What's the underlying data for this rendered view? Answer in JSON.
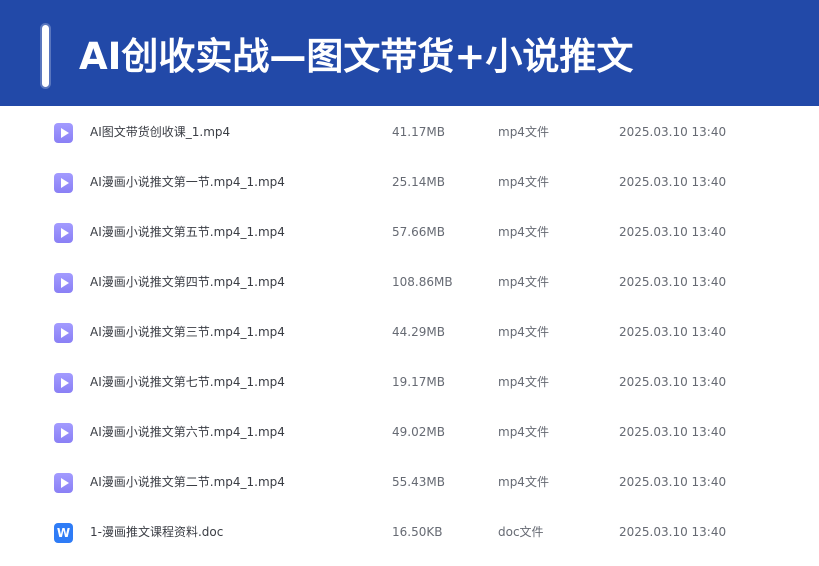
{
  "header": {
    "title": "AI创收实战—图文带货+小说推文"
  },
  "files": [
    {
      "icon": "video-file-icon",
      "name": "AI图文带货创收课_1.mp4",
      "size": "41.17MB",
      "type": "mp4文件",
      "modified": "2025.03.10 13:40"
    },
    {
      "icon": "video-file-icon",
      "name": "AI漫画小说推文第一节.mp4_1.mp4",
      "size": "25.14MB",
      "type": "mp4文件",
      "modified": "2025.03.10 13:40"
    },
    {
      "icon": "video-file-icon",
      "name": "AI漫画小说推文第五节.mp4_1.mp4",
      "size": "57.66MB",
      "type": "mp4文件",
      "modified": "2025.03.10 13:40"
    },
    {
      "icon": "video-file-icon",
      "name": "AI漫画小说推文第四节.mp4_1.mp4",
      "size": "108.86MB",
      "type": "mp4文件",
      "modified": "2025.03.10 13:40"
    },
    {
      "icon": "video-file-icon",
      "name": "AI漫画小说推文第三节.mp4_1.mp4",
      "size": "44.29MB",
      "type": "mp4文件",
      "modified": "2025.03.10 13:40"
    },
    {
      "icon": "video-file-icon",
      "name": "AI漫画小说推文第七节.mp4_1.mp4",
      "size": "19.17MB",
      "type": "mp4文件",
      "modified": "2025.03.10 13:40"
    },
    {
      "icon": "video-file-icon",
      "name": "AI漫画小说推文第六节.mp4_1.mp4",
      "size": "49.02MB",
      "type": "mp4文件",
      "modified": "2025.03.10 13:40"
    },
    {
      "icon": "video-file-icon",
      "name": "AI漫画小说推文第二节.mp4_1.mp4",
      "size": "55.43MB",
      "type": "mp4文件",
      "modified": "2025.03.10 13:40"
    },
    {
      "icon": "word-doc-icon",
      "icon_letter": "W",
      "name": "1-漫画推文课程资料.doc",
      "size": "16.50KB",
      "type": "doc文件",
      "modified": "2025.03.10 13:40"
    }
  ],
  "colors": {
    "banner_background": "#2249a8",
    "banner_text": "#ffffff",
    "video_icon": "#8a80f5",
    "word_icon": "#2f7cf6",
    "name_text": "#3a3d44",
    "meta_text": "#666a73"
  }
}
